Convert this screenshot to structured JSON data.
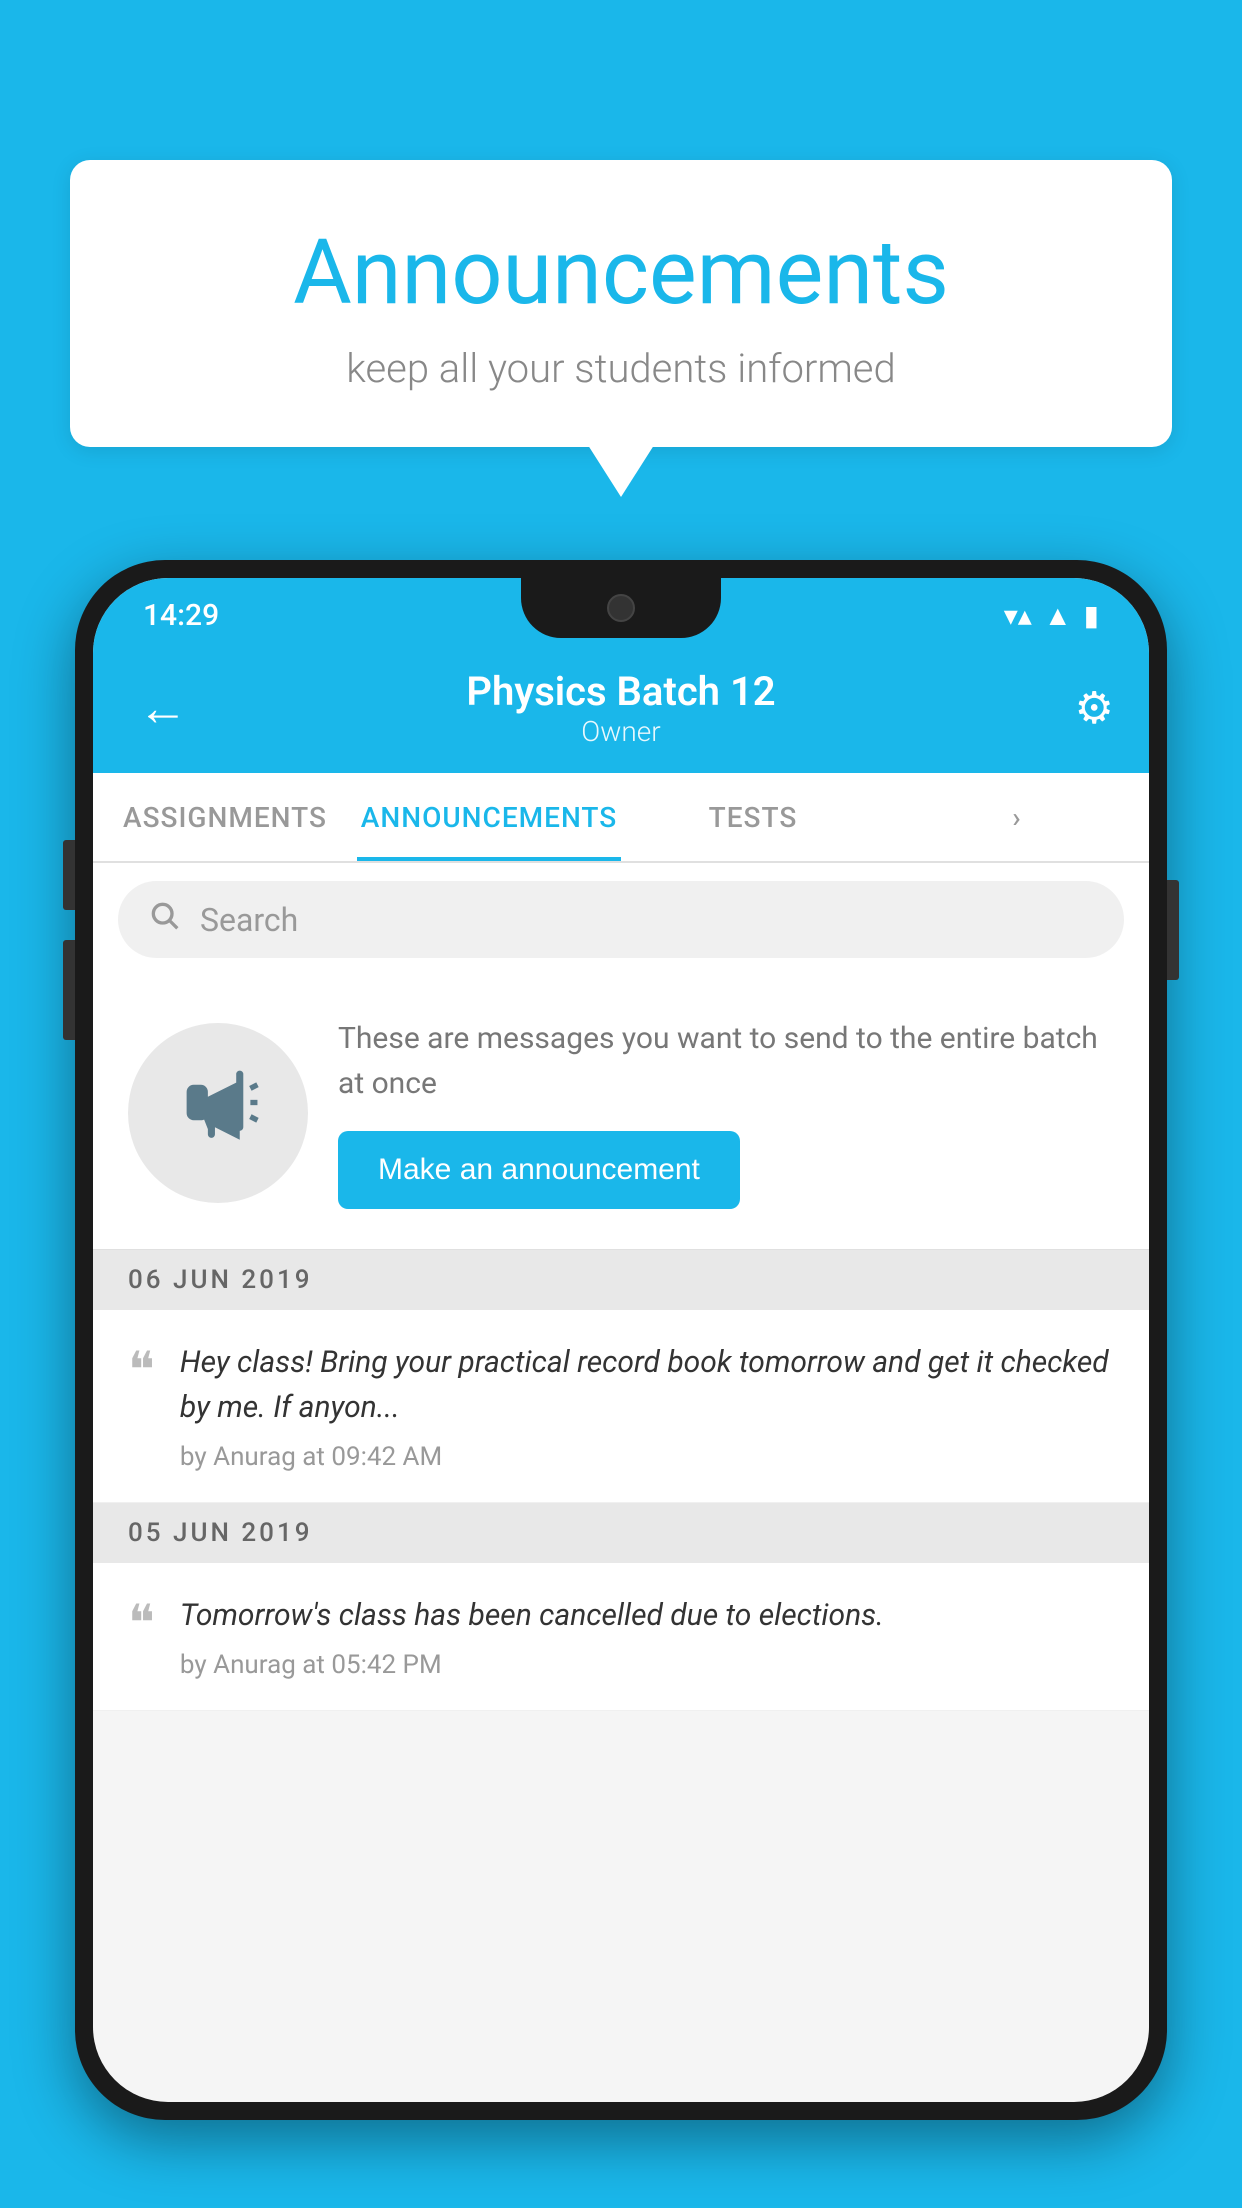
{
  "background_color": "#1ab7ea",
  "speech_bubble": {
    "title": "Announcements",
    "subtitle": "keep all your students informed"
  },
  "phone": {
    "status_bar": {
      "time": "14:29",
      "wifi": "▼",
      "signal": "▲",
      "battery": "■"
    },
    "app_bar": {
      "back_label": "←",
      "title": "Physics Batch 12",
      "subtitle": "Owner",
      "gear_label": "⚙"
    },
    "tabs": [
      {
        "label": "ASSIGNMENTS",
        "active": false
      },
      {
        "label": "ANNOUNCEMENTS",
        "active": true
      },
      {
        "label": "TESTS",
        "active": false
      },
      {
        "label": "",
        "active": false
      }
    ],
    "search": {
      "placeholder": "Search"
    },
    "promo": {
      "description": "These are messages you want to send to the entire batch at once",
      "button_label": "Make an announcement"
    },
    "announcement_groups": [
      {
        "date": "06  JUN  2019",
        "items": [
          {
            "text": "Hey class! Bring your practical record book tomorrow and get it checked by me. If anyon...",
            "meta": "by Anurag at 09:42 AM"
          }
        ]
      },
      {
        "date": "05  JUN  2019",
        "items": [
          {
            "text": "Tomorrow's class has been cancelled due to elections.",
            "meta": "by Anurag at 05:42 PM"
          }
        ]
      }
    ]
  }
}
